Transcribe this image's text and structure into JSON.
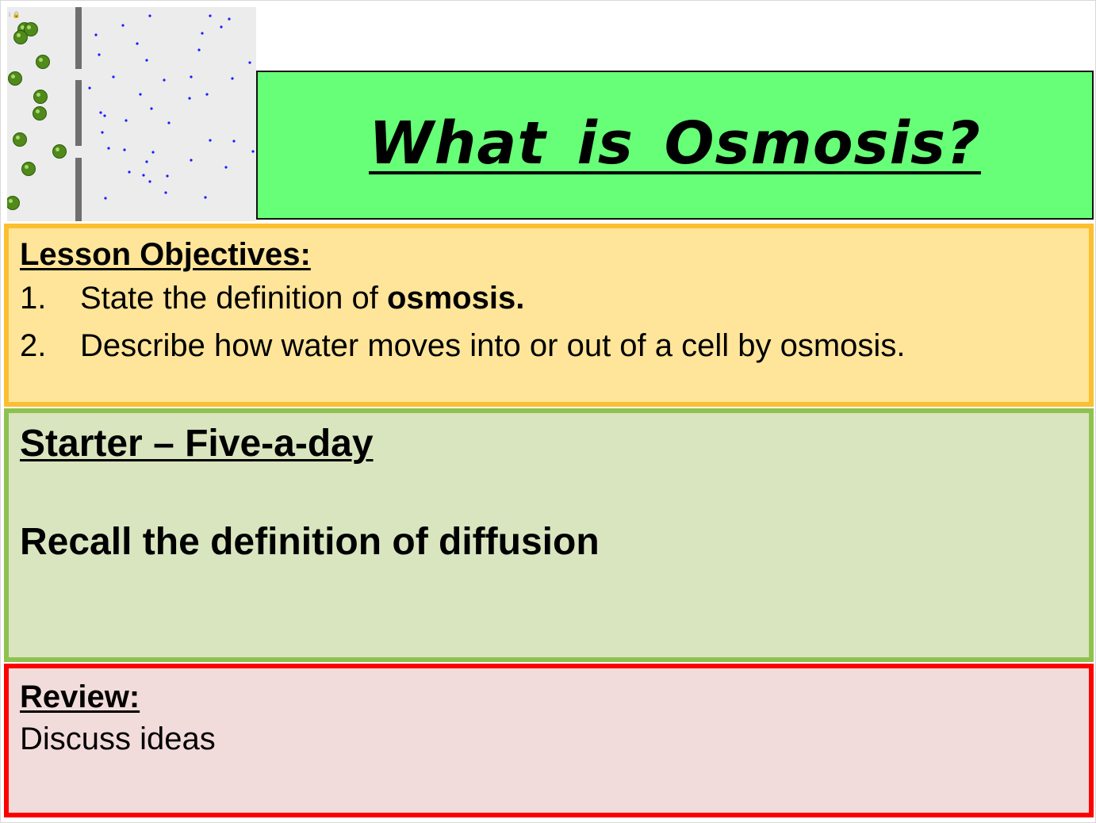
{
  "title": "What is Osmosis?",
  "simulation": {
    "icon": "osmosis-animation",
    "membrane_color": "#6f6f6f",
    "solute_color": "#4f8a1b",
    "water_color": "#1a1aff"
  },
  "objectives": {
    "heading": "Lesson Objectives:",
    "items": [
      {
        "number": "1.",
        "text_plain": "State the definition of ",
        "text_bold": "osmosis."
      },
      {
        "number": "2.",
        "text_plain": "Describe how water moves into or out of a cell by osmosis.",
        "text_bold": ""
      }
    ]
  },
  "starter": {
    "heading": "Starter – Five-a-day",
    "task": "Recall the definition of diffusion"
  },
  "review": {
    "heading": "Review:",
    "text": "Discuss ideas"
  },
  "colors": {
    "title_bg": "#66ff77",
    "objectives_bg": "#ffe599",
    "objectives_border": "#fbbf2f",
    "starter_bg": "#d9e5bf",
    "starter_border": "#8fc150",
    "review_bg": "#f2dcdb",
    "review_border": "#ff0000"
  }
}
